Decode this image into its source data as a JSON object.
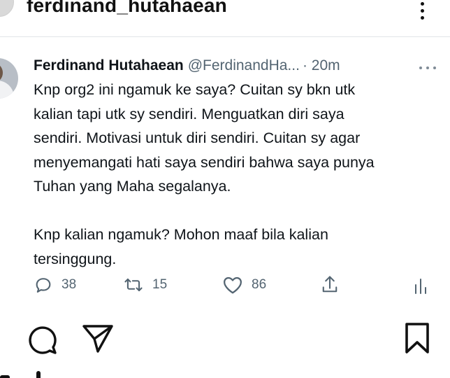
{
  "instagram": {
    "header": {
      "username": "ferdinand_hutahaean"
    },
    "actions": {
      "like_icon": "heart-icon",
      "comment_icon": "comment-icon",
      "share_icon": "send-icon",
      "save_icon": "bookmark-icon"
    }
  },
  "tweet": {
    "author_name": "Ferdinand Hutahaean",
    "author_handle": "@FerdinandHa...",
    "time": "· 20m",
    "text": "Knp org2 ini ngamuk ke saya? Cuitan sy bkn utk\nkalian tapi utk sy sendiri. Menguatkan diri saya\nsendiri. Motivasi untuk diri sendiri. Cuitan sy agar\nmenyemangati hati saya sendiri bahwa saya punya\nTuhan yang Maha segalanya.\n\nKnp kalian ngamuk? Mohon maaf bila kalian\ntersinggung.",
    "stats": {
      "replies": "38",
      "retweets": "15",
      "likes": "86"
    }
  },
  "colors": {
    "text": "#0f1419",
    "secondary": "#536471",
    "divider": "#e2e5e8"
  }
}
